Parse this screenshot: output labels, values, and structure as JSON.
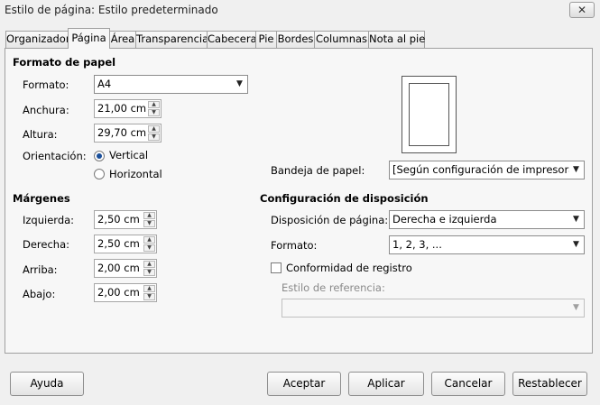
{
  "window": {
    "title": "Estilo de página: Estilo predeterminado",
    "close_glyph": "✕"
  },
  "tabs": [
    {
      "label": "Organizador"
    },
    {
      "label": "Página"
    },
    {
      "label": "Área"
    },
    {
      "label": "Transparencia"
    },
    {
      "label": "Cabecera"
    },
    {
      "label": "Pie"
    },
    {
      "label": "Bordes"
    },
    {
      "label": "Columnas"
    },
    {
      "label": "Nota al pie"
    }
  ],
  "paper_format": {
    "heading": "Formato de papel",
    "format_label": "Formato:",
    "format_value": "A4",
    "width_label": "Anchura:",
    "width_value": "21,00 cm",
    "height_label": "Altura:",
    "height_value": "29,70 cm",
    "orientation_label": "Orientación:",
    "vertical_label": "Vertical",
    "horizontal_label": "Horizontal",
    "orientation_selected": "Vertical",
    "tray_label": "Bandeja de papel:",
    "tray_value": "[Según configuración de impresora]"
  },
  "margins": {
    "heading": "Márgenes",
    "left_label": "Izquierda:",
    "left_value": "2,50 cm",
    "right_label": "Derecha:",
    "right_value": "2,50 cm",
    "top_label": "Arriba:",
    "top_value": "2,00 cm",
    "bottom_label": "Abajo:",
    "bottom_value": "2,00 cm"
  },
  "layout": {
    "heading": "Configuración de disposición",
    "page_layout_label": "Disposición de página:",
    "page_layout_value": "Derecha e izquierda",
    "format_label": "Formato:",
    "format_value": "1, 2, 3, ...",
    "register_label": "Conformidad de registro",
    "register_checked": false,
    "reference_style_label": "Estilo de referencia:",
    "reference_style_value": ""
  },
  "buttons": {
    "help": "Ayuda",
    "ok": "Aceptar",
    "apply": "Aplicar",
    "cancel": "Cancelar",
    "reset": "Restablecer"
  },
  "icons": {
    "dropdown": "chevron-down-icon",
    "spin_up": "triangle-up-icon",
    "spin_down": "triangle-down-icon"
  }
}
